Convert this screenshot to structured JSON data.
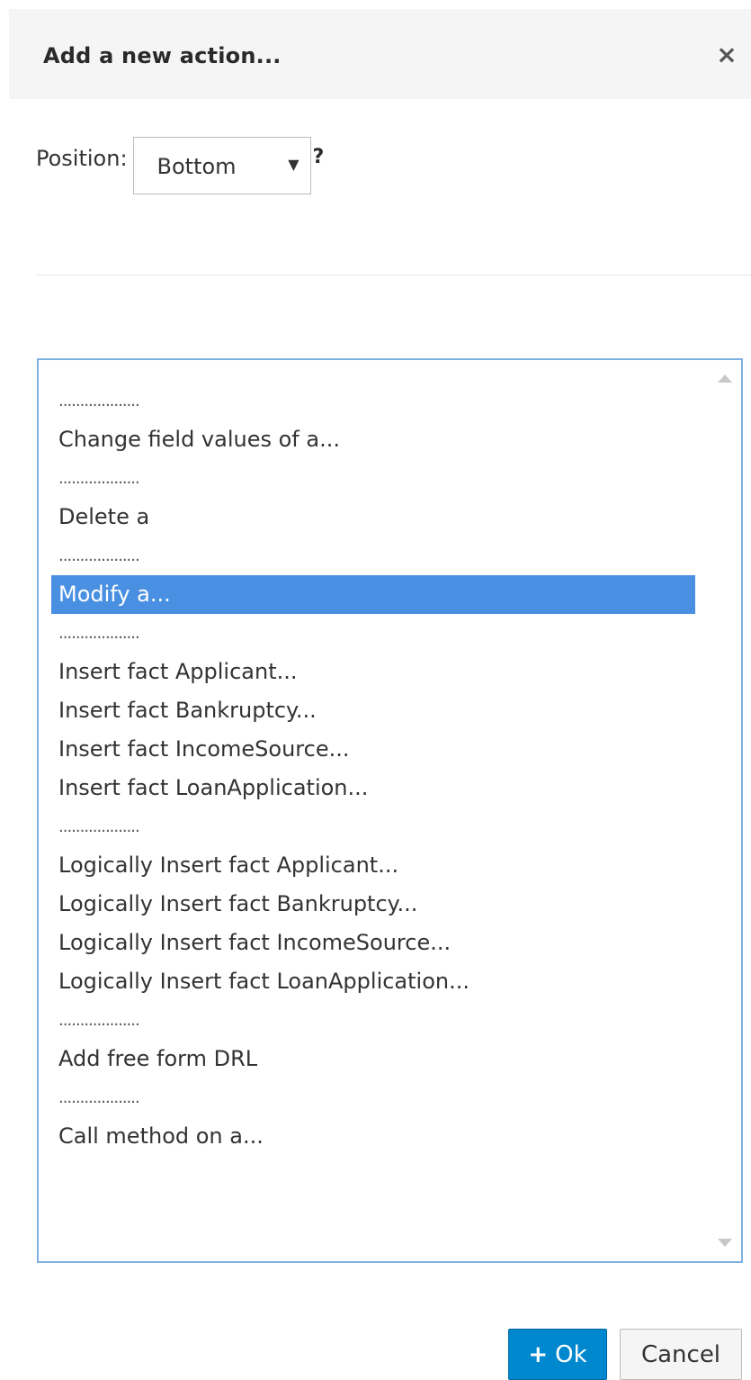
{
  "dialog": {
    "title": "Add a new action...",
    "close_icon": "×"
  },
  "position": {
    "label": "Position:",
    "selected": "Bottom",
    "arrow_icon": "▼",
    "help": "?"
  },
  "action_list": {
    "selected_index": 6,
    "items": [
      "...................",
      "Change field values of a...",
      "...................",
      "Delete a",
      "...................",
      "Modify a...",
      "...................",
      "Insert fact Applicant...",
      "Insert fact Bankruptcy...",
      "Insert fact IncomeSource...",
      "Insert fact LoanApplication...",
      "...................",
      "Logically Insert fact Applicant...",
      "Logically Insert fact Bankruptcy...",
      "Logically Insert fact IncomeSource...",
      "Logically Insert fact LoanApplication...",
      "...................",
      "Add free form DRL",
      "...................",
      "Call method on a..."
    ]
  },
  "buttons": {
    "ok_icon": "+",
    "ok_label": "Ok",
    "cancel_label": "Cancel"
  },
  "colors": {
    "primary": "#0088ce",
    "selection": "#4a90e2",
    "list_border": "#7fb0e0"
  }
}
